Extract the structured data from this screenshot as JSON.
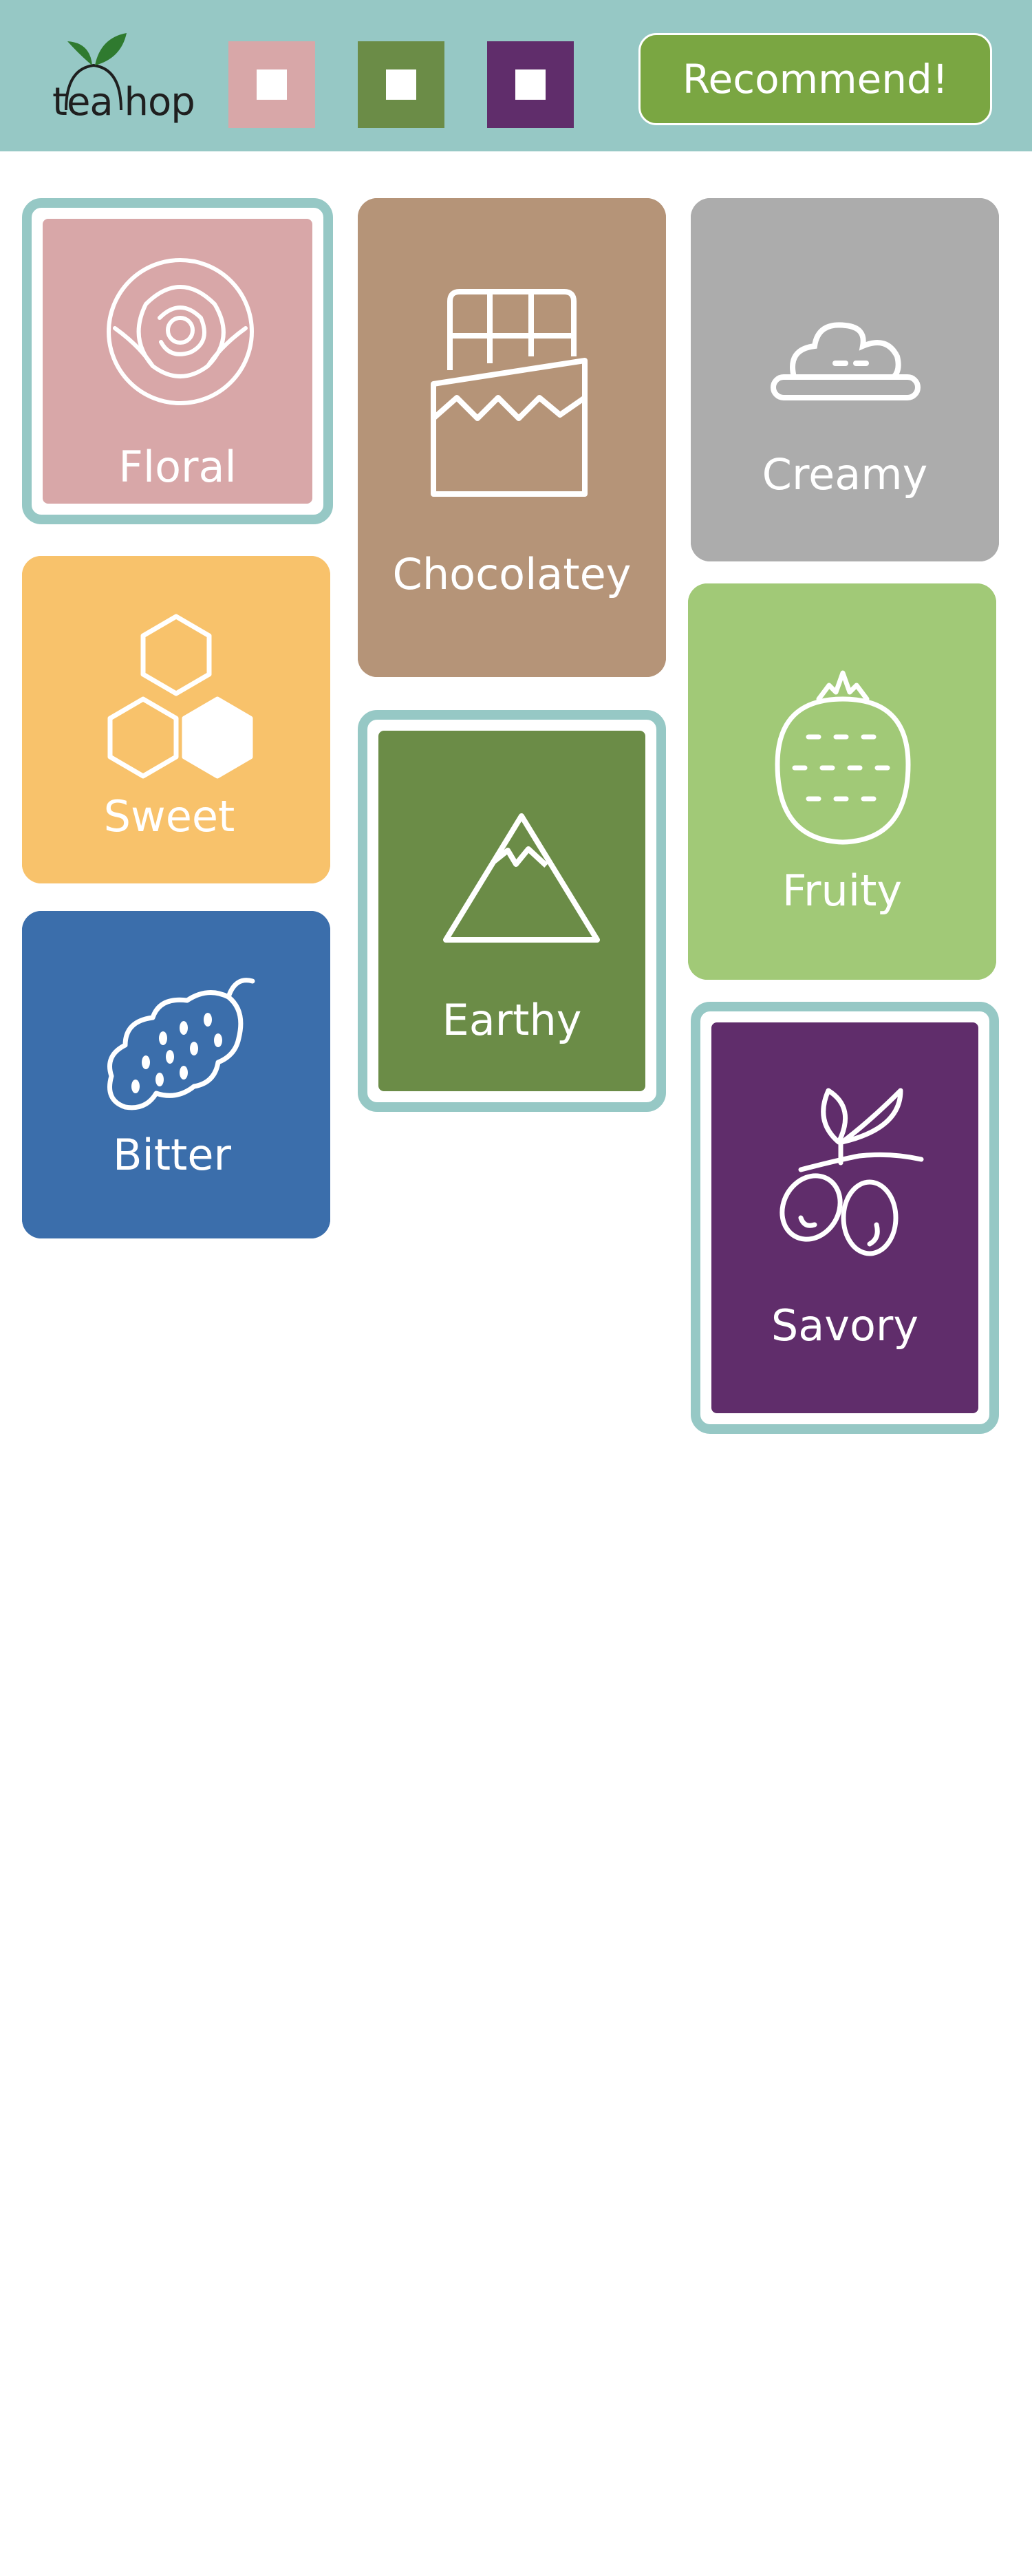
{
  "app": {
    "logo_text": "tea hop"
  },
  "header": {
    "swatches": [
      {
        "name": "floral",
        "color": "#d8a7a8"
      },
      {
        "name": "earthy",
        "color": "#6b8c47"
      },
      {
        "name": "savory",
        "color": "#602d6b"
      }
    ],
    "recommend_label": "Recommend!"
  },
  "tiles": [
    {
      "key": "floral",
      "label": "Floral",
      "color": "#d8a7a8",
      "selected": true,
      "icon": "rose-icon"
    },
    {
      "key": "chocolatey",
      "label": "Chocolatey",
      "color": "#b59478",
      "selected": false,
      "icon": "chocolate-bar-icon"
    },
    {
      "key": "creamy",
      "label": "Creamy",
      "color": "#acacac",
      "selected": false,
      "icon": "cream-icon"
    },
    {
      "key": "sweet",
      "label": "Sweet",
      "color": "#f8c26b",
      "selected": false,
      "icon": "honeycomb-icon"
    },
    {
      "key": "earthy",
      "label": "Earthy",
      "color": "#6b8c47",
      "selected": true,
      "icon": "mountain-icon"
    },
    {
      "key": "fruity",
      "label": "Fruity",
      "color": "#a1c977",
      "selected": false,
      "icon": "strawberry-icon"
    },
    {
      "key": "bitter",
      "label": "Bitter",
      "color": "#3b6eab",
      "selected": false,
      "icon": "bitter-melon-icon"
    },
    {
      "key": "savory",
      "label": "Savory",
      "color": "#602d6b",
      "selected": true,
      "icon": "olive-branch-icon"
    }
  ],
  "colors": {
    "header_bg": "#96c8c5",
    "selected_border": "#96c8c5",
    "button_bg": "#7aa642"
  }
}
